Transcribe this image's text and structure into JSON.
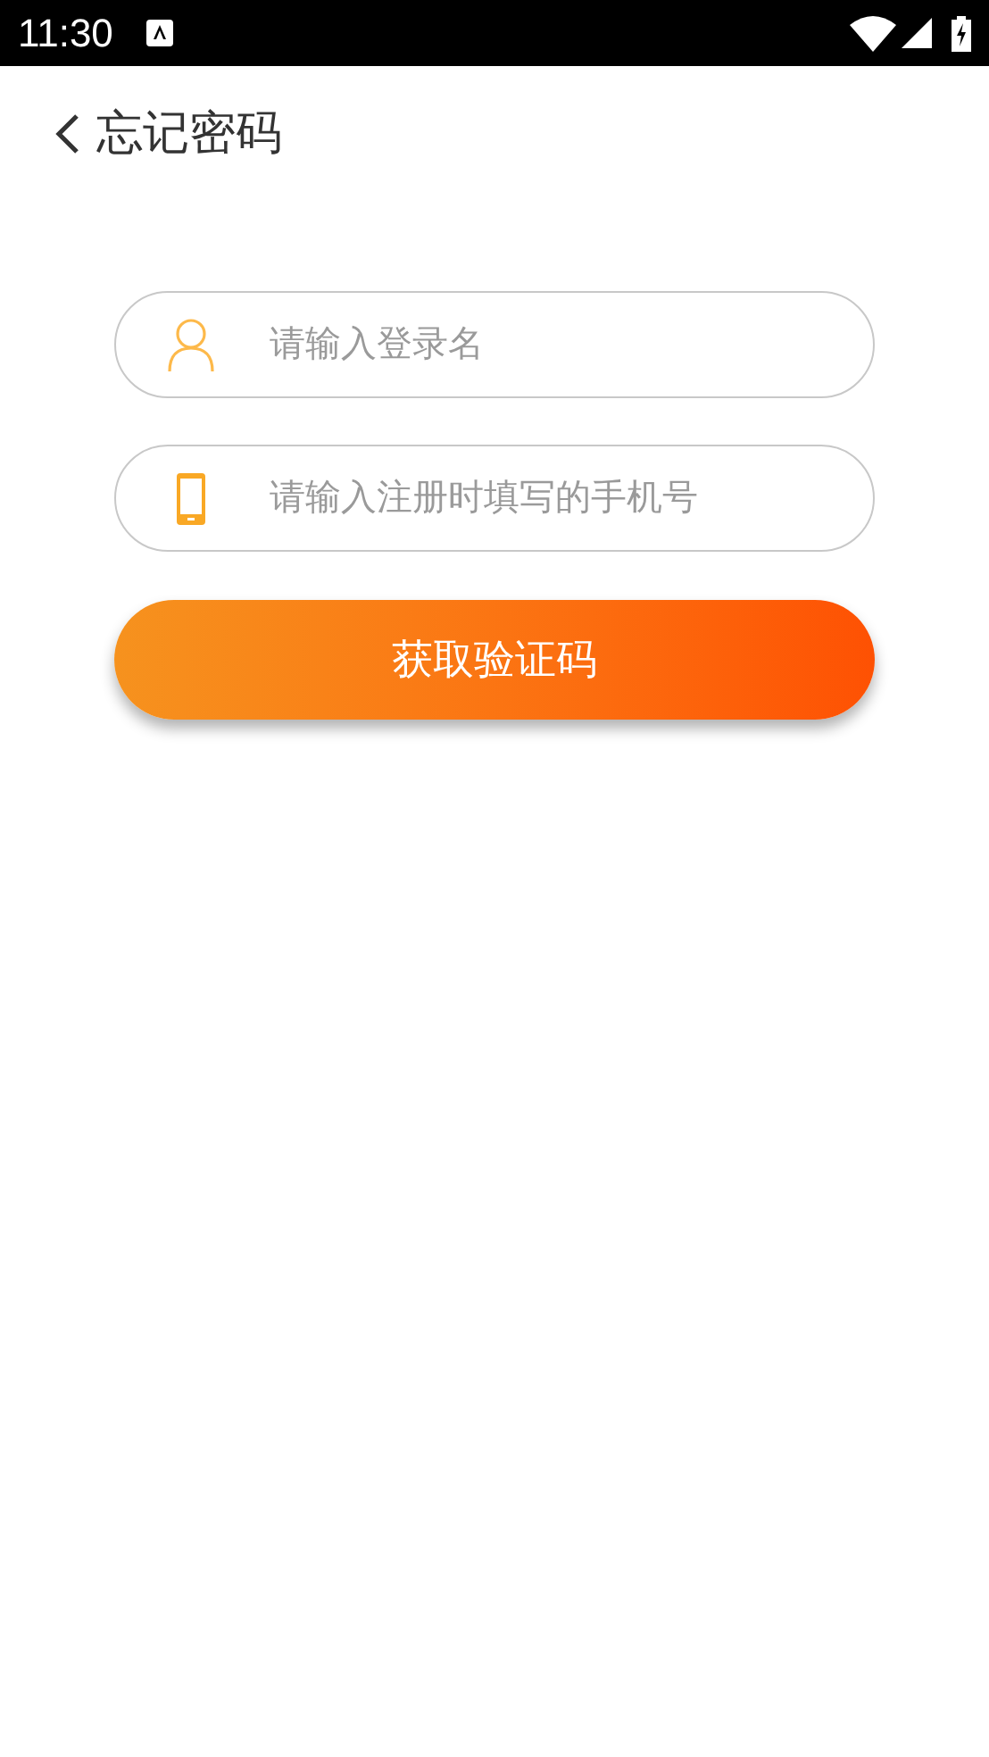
{
  "status_bar": {
    "time": "11:30"
  },
  "header": {
    "title": "忘记密码"
  },
  "fields": [
    {
      "kind": "user",
      "placeholder": "请输入登录名"
    },
    {
      "kind": "phone",
      "placeholder": "请输入注册时填写的手机号"
    }
  ],
  "submit_button": {
    "label": "获取验证码"
  }
}
